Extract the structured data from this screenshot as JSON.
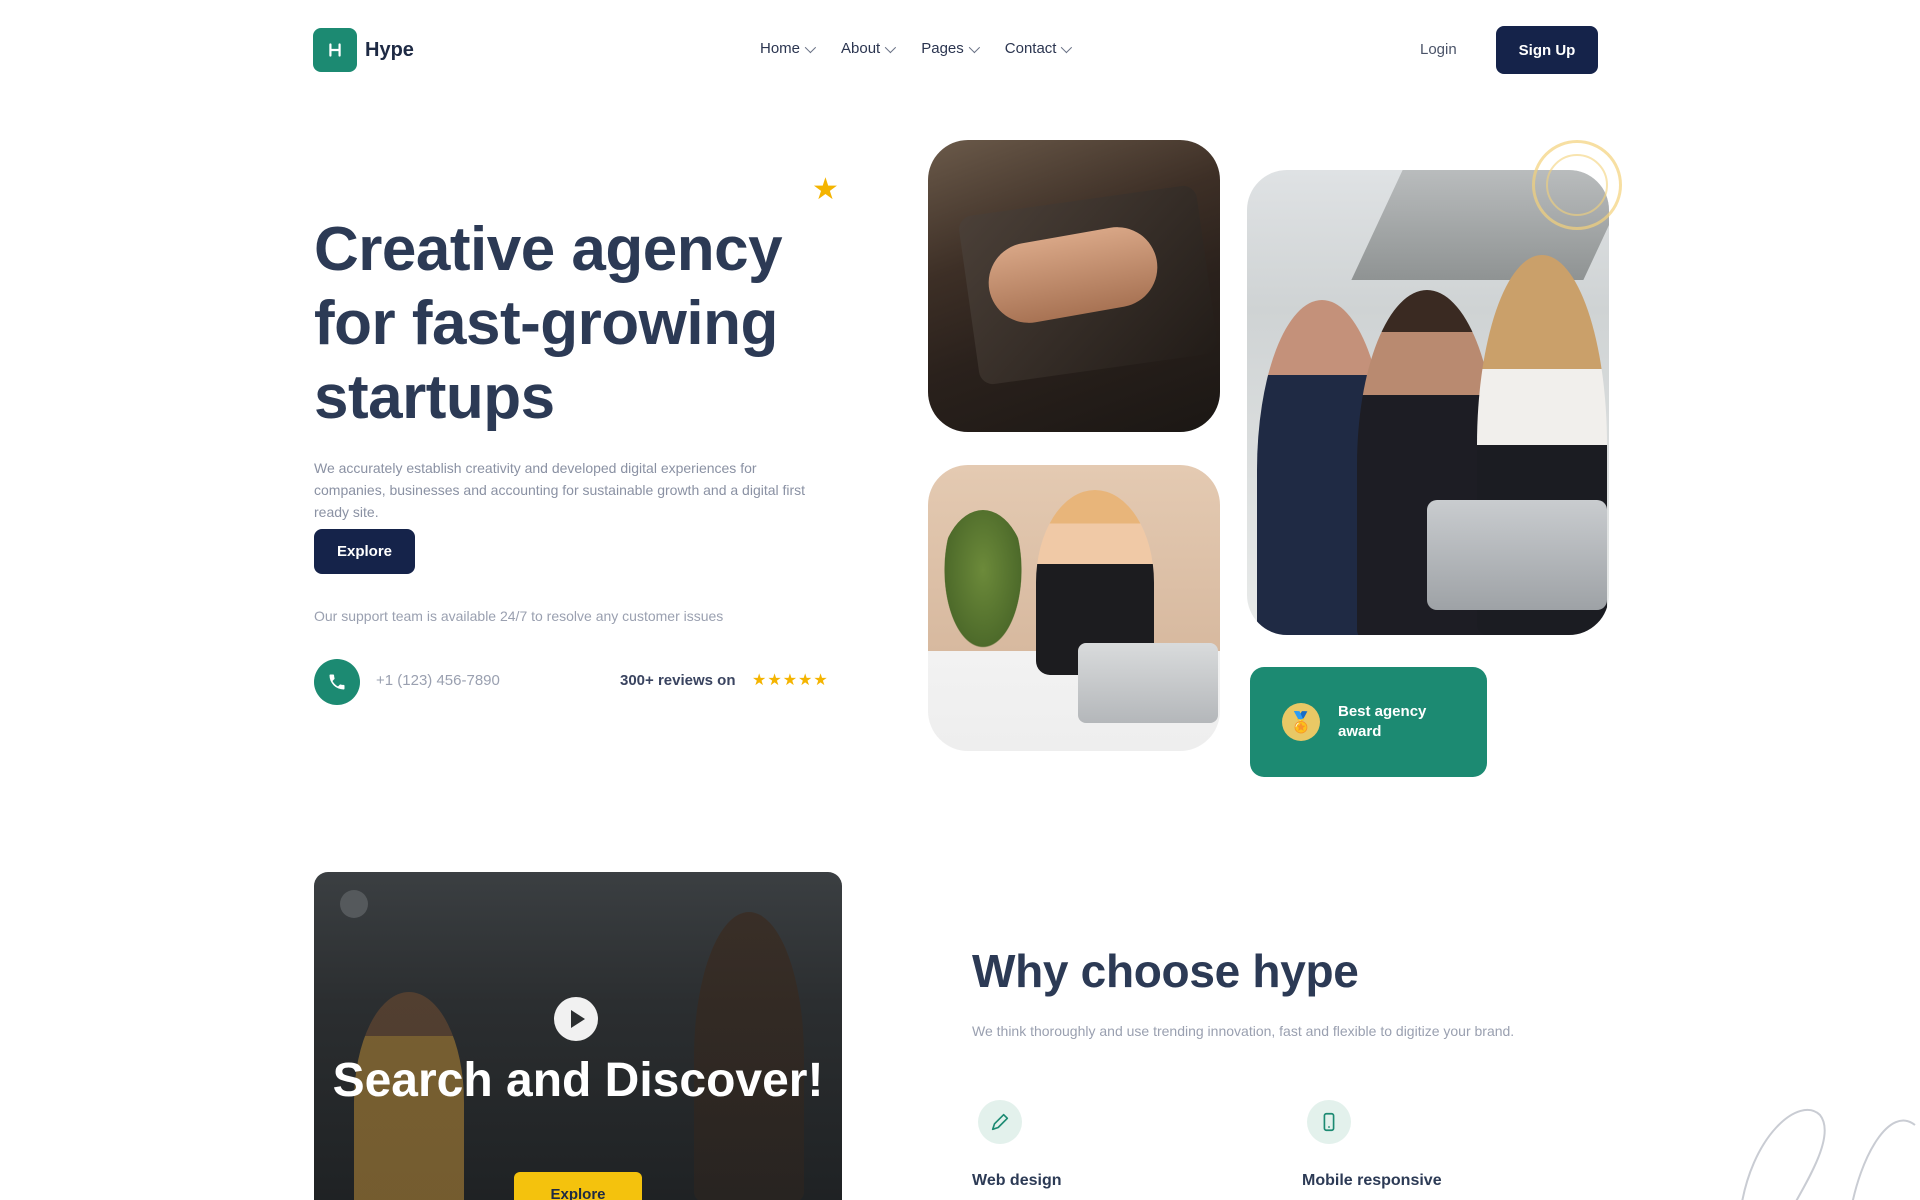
{
  "header": {
    "logo_text": "Hype",
    "nav": [
      {
        "label": "Home"
      },
      {
        "label": "About"
      },
      {
        "label": "Pages"
      },
      {
        "label": "Contact"
      }
    ],
    "login_label": "Login",
    "signup_label": "Sign Up"
  },
  "hero": {
    "title": "Creative agency for fast-growing startups",
    "description": "We accurately establish creativity and developed digital experiences for companies, businesses and accounting for sustainable growth and a digital first ready site.",
    "cta_label": "Explore",
    "note": "Our support team is available 24/7 to resolve any customer issues",
    "phone": "+1 (123) 456-7890",
    "reviews_label": "300+ reviews on",
    "stars": "★★★★★"
  },
  "badge": {
    "label": "Best agency award",
    "icon": "award-icon"
  },
  "video": {
    "title": "Search and Discover!",
    "button_label": "Explore"
  },
  "why": {
    "title": "Why choose hype",
    "description": "We think thoroughly and use trending innovation, fast and flexible to digitize your brand.",
    "features": [
      {
        "label": "Web design",
        "icon": "design-icon"
      },
      {
        "label": "Mobile responsive",
        "icon": "mobile-icon"
      }
    ]
  },
  "colors": {
    "brand_green": "#1c8a72",
    "navy": "#15234a",
    "accent_yellow": "#f4b400"
  }
}
